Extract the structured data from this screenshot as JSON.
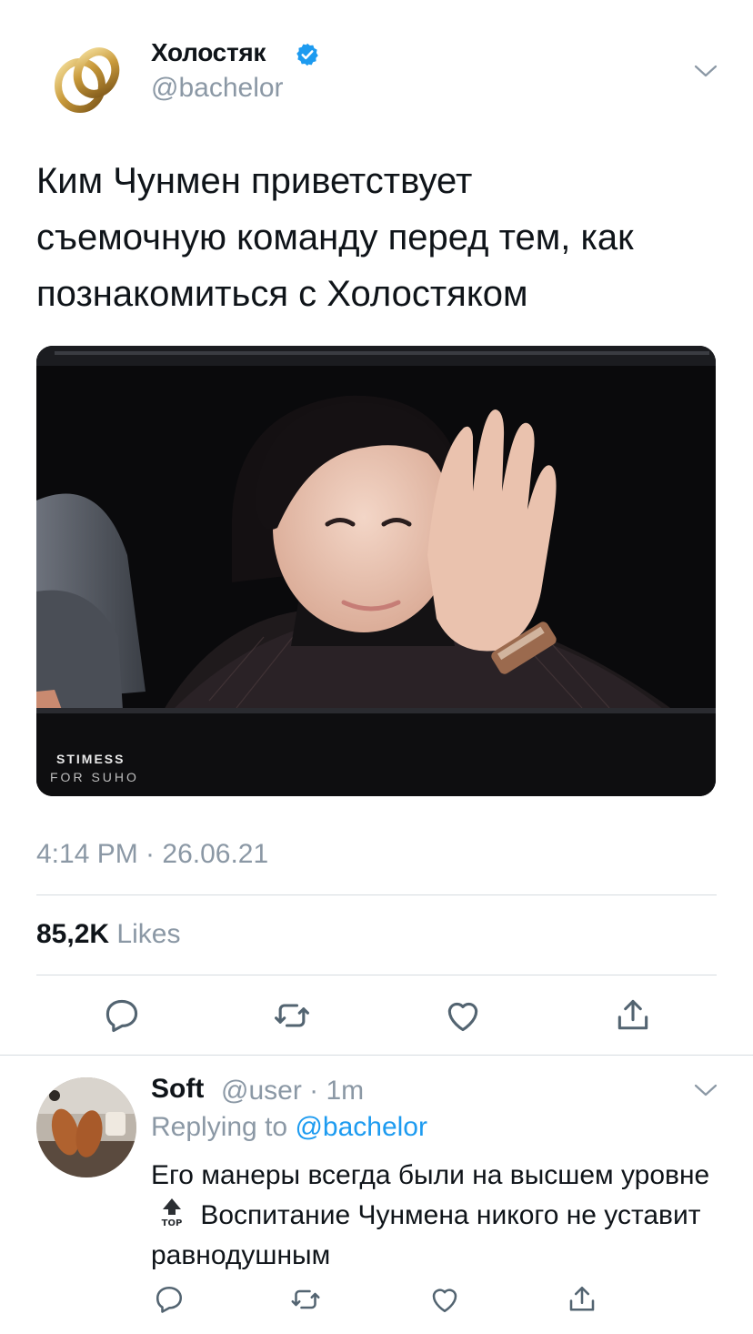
{
  "tweet": {
    "display_name": "Холостяк",
    "handle": "@bachelor",
    "verified": true,
    "text": "Ким Чунмен приветствует\nсъемочную команду перед тем, как\nпознакомиться с Холостяком",
    "image_watermark_line1": "STIMESS",
    "image_watermark_line2": "FOR SUHO",
    "timestamp": "4:14 PM · 26.06.21",
    "likes_count": "85,2K",
    "likes_label": "Likes",
    "actions": [
      "reply-icon",
      "retweet-icon",
      "like-icon",
      "share-icon"
    ]
  },
  "reply": {
    "display_name": "Soft",
    "handle_time": "@user · 1m",
    "replying_prefix": "Replying to",
    "replying_handle": "@bachelor",
    "text_part1": "Его манеры всегда были на высшем уровне",
    "emoji_label": "TOP",
    "text_part2": "Воспитание Чунмена никого не уставит равнодушным"
  },
  "colors": {
    "accent": "#1d9bf0",
    "secondary_text": "#8b98a5",
    "primary_text": "#0f1419",
    "divider": "#d6dbe0"
  }
}
